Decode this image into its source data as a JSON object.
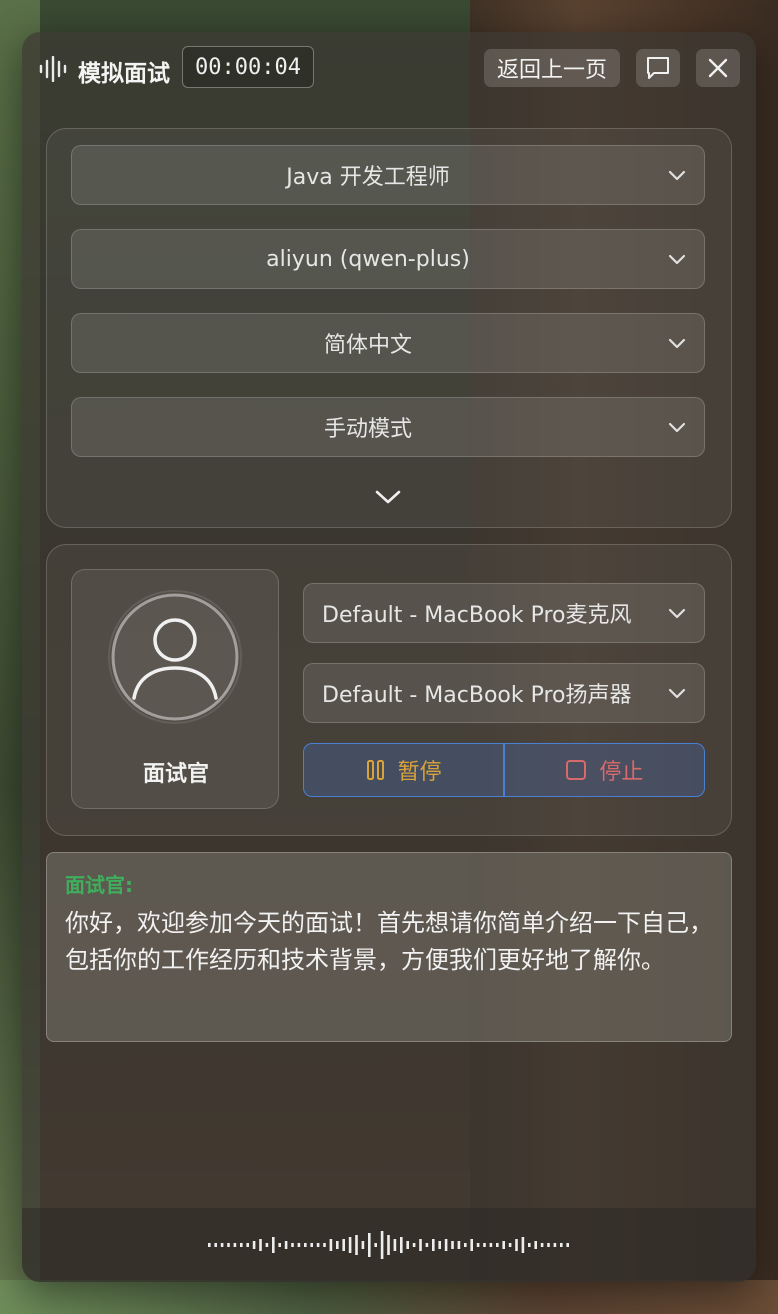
{
  "header": {
    "title": "模拟面试",
    "timer": "00:00:04",
    "back_label": "返回上一页",
    "icons": {
      "logo": "waveform-icon",
      "chat": "message-square-icon",
      "close": "close-icon"
    }
  },
  "settings": {
    "position": "Java 开发工程师",
    "model": "aliyun (qwen-plus)",
    "language": "简体中文",
    "mode": "手动模式"
  },
  "interviewer": {
    "label": "面试官",
    "microphone": "Default - MacBook Pro麦克风",
    "speaker": "Default - MacBook Pro扬声器",
    "pause_label": "暂停",
    "stop_label": "停止"
  },
  "transcript": {
    "speaker": "面试官:",
    "message": "你好，欢迎参加今天的面试！首先想请你简单介绍一下自己，包括你的工作经历和技术背景，方便我们更好地了解你。"
  },
  "colors": {
    "pause": "#d9a33a",
    "stop": "#d86a6a",
    "accent_border": "#4a7fd6",
    "speaker_name": "#3fae5d"
  }
}
